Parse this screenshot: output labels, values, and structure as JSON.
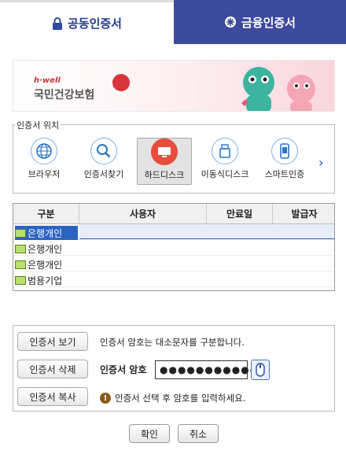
{
  "tabs": {
    "public_cert": "공동인증서",
    "financial_cert": "금융인증서"
  },
  "banner": {
    "brand": "h·well",
    "org": "국민건강보험"
  },
  "location": {
    "legend": "인증서 위치",
    "items": [
      "브라우저",
      "인증서찾기",
      "하드디스크",
      "이동식디스크",
      "스마트인증"
    ],
    "selected": "하드디스크"
  },
  "table": {
    "headers": [
      "구분",
      "사용자",
      "만료일",
      "발급자"
    ],
    "rows": [
      "은행개인",
      "은행개인",
      "은행개인",
      "범용기업"
    ],
    "selected_row": 0
  },
  "panel": {
    "view_button": "인증서 보기",
    "delete_button": "인증서 삭제",
    "copy_button": "인증서 복사",
    "case_note": "인증서 암호는 대소문자를 구분합니다.",
    "password_label": "인증서 암호",
    "password_value": "●●●●●●●●●●●●",
    "warning": "인증서 선택 후 암호를 입력하세요."
  },
  "buttons": {
    "ok": "확인",
    "cancel": "취소"
  },
  "colors": {
    "tab_active_bg": "#3d4a9e",
    "selection": "#2a63c2"
  }
}
